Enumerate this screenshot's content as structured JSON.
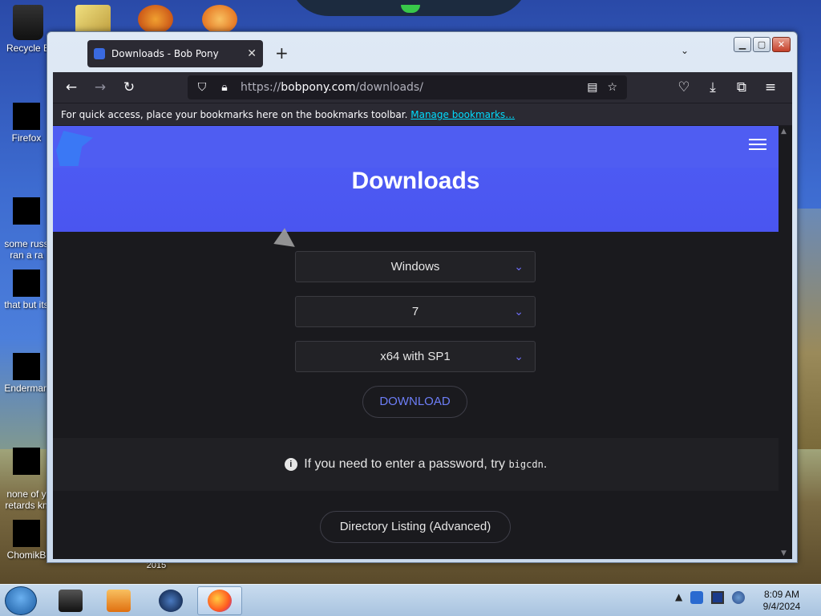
{
  "desktop": {
    "icons": [
      {
        "label": "Recycle B"
      },
      {
        "label": "Firefox"
      },
      {
        "label": "some russ\nran a ra"
      },
      {
        "label": "that but its"
      },
      {
        "label": "Enderman"
      },
      {
        "label": "none of y\nretards kn"
      },
      {
        "label": "ChomikB"
      }
    ],
    "stray_label": "2015"
  },
  "browser": {
    "tab_title": "Downloads - Bob Pony",
    "new_tab_label": "+",
    "url_prefix": "https://",
    "url_host": "bobpony.com",
    "url_path": "/downloads/",
    "bookmarks_text": "For quick access, place your bookmarks here on the bookmarks toolbar.",
    "bookmarks_link": "Manage bookmarks…"
  },
  "page": {
    "title": "Downloads",
    "os_select": "Windows",
    "version_select": "7",
    "edition_select": "x64 with SP1",
    "download_label": "DOWNLOAD",
    "notice_text": "If you need to enter a password, try",
    "notice_code": "bigcdn",
    "notice_end": ".",
    "directory_label": "Directory Listing (Advanced)"
  },
  "taskbar": {
    "time": "8:09 AM",
    "date": "9/4/2024"
  },
  "colors": {
    "hero": "#4f5df2",
    "accent_link": "#00ddff",
    "select_chevron": "#6d6df5",
    "download_text": "#6d7ef7"
  }
}
